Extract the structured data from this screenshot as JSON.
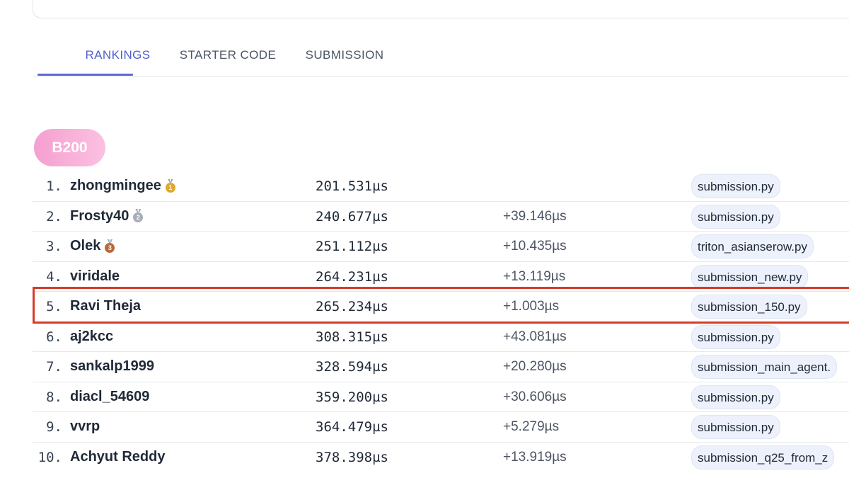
{
  "tabs": [
    {
      "label": "RANKINGS",
      "active": true
    },
    {
      "label": "STARTER CODE",
      "active": false
    },
    {
      "label": "SUBMISSION",
      "active": false
    }
  ],
  "gpu_badge": "B200",
  "highlighted_rank": "5.",
  "leaderboard": [
    {
      "rank": "1.",
      "user": "zhongmingee",
      "medal": "gold-medal-icon",
      "time": "201.531µs",
      "delta": "",
      "file": "submission.py"
    },
    {
      "rank": "2.",
      "user": "Frosty40",
      "medal": "silver-medal-icon",
      "time": "240.677µs",
      "delta": "+39.146µs",
      "file": "submission.py"
    },
    {
      "rank": "3.",
      "user": "Olek",
      "medal": "bronze-medal-icon",
      "time": "251.112µs",
      "delta": "+10.435µs",
      "file": "triton_asianserow.py"
    },
    {
      "rank": "4.",
      "user": "viridale",
      "medal": "",
      "time": "264.231µs",
      "delta": "+13.119µs",
      "file": "submission_new.py"
    },
    {
      "rank": "5.",
      "user": "Ravi Theja",
      "medal": "",
      "time": "265.234µs",
      "delta": "+1.003µs",
      "file": "submission_150.py"
    },
    {
      "rank": "6.",
      "user": "aj2kcc",
      "medal": "",
      "time": "308.315µs",
      "delta": "+43.081µs",
      "file": "submission.py"
    },
    {
      "rank": "7.",
      "user": "sankalp1999",
      "medal": "",
      "time": "328.594µs",
      "delta": "+20.280µs",
      "file": "submission_main_agent."
    },
    {
      "rank": "8.",
      "user": "diacl_54609",
      "medal": "",
      "time": "359.200µs",
      "delta": "+30.606µs",
      "file": "submission.py"
    },
    {
      "rank": "9.",
      "user": "vvrp",
      "medal": "",
      "time": "364.479µs",
      "delta": "+5.279µs",
      "file": "submission.py"
    },
    {
      "rank": "10.",
      "user": "Achyut Reddy",
      "medal": "",
      "time": "378.398µs",
      "delta": "+13.919µs",
      "file": "submission_q25_from_z"
    }
  ],
  "colors": {
    "accent": "#4f5fc9",
    "badge_gradient_start": "#f59fd0",
    "badge_gradient_end": "#fbc1e1",
    "highlight_border": "#d63b2a",
    "gold": "#e0a92a",
    "silver": "#a8aeb8",
    "bronze": "#b86a3b"
  }
}
